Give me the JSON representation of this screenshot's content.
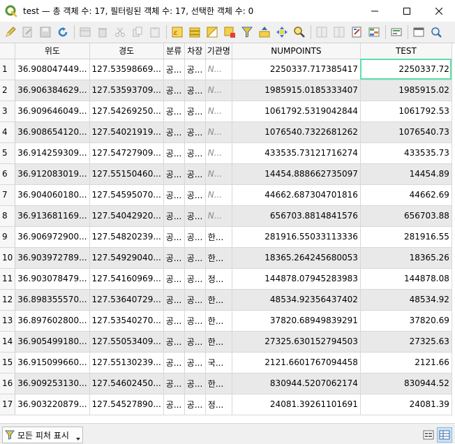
{
  "window": {
    "title": "test — 총 객체 수: 17, 필터링된 객체 수: 17, 선택한 객체 수: 0"
  },
  "toolbar": {
    "buttons": [
      "edit-pencil-icon",
      "multi-edit-icon",
      "save-icon",
      "reload-icon",
      "add-feature-icon",
      "delete-feature-icon",
      "cut-icon",
      "copy-icon",
      "paste-icon",
      "expression-select-icon",
      "select-all-icon",
      "invert-selection-icon",
      "deselect-icon",
      "filter-icon",
      "move-selection-top-icon",
      "pan-to-selection-icon",
      "zoom-to-selection-icon",
      "new-field-icon",
      "delete-field-icon",
      "field-calculator-icon",
      "conditional-format-icon",
      "actions-icon",
      "dock-icon",
      "attribute-form-icon"
    ]
  },
  "table": {
    "headers": [
      "위도",
      "경도",
      "분류",
      "차장",
      "기관명",
      "NUMPOINTS",
      "TEST"
    ],
    "rows": [
      {
        "n": "1",
        "lat": "36.908047449...",
        "lon": "127.53598669...",
        "cls": "공...",
        "car": "공...",
        "org": "N...",
        "np": "2250337.717385417",
        "test": "2250337.72"
      },
      {
        "n": "2",
        "lat": "36.906384629...",
        "lon": "127.53593709...",
        "cls": "공...",
        "car": "공...",
        "org": "N...",
        "np": "1985915.0185333407",
        "test": "1985915.02"
      },
      {
        "n": "3",
        "lat": "36.909646049...",
        "lon": "127.54269250...",
        "cls": "공...",
        "car": "공...",
        "org": "N...",
        "np": "1061792.5319042844",
        "test": "1061792.53"
      },
      {
        "n": "4",
        "lat": "36.908654120...",
        "lon": "127.54021919...",
        "cls": "공...",
        "car": "공...",
        "org": "N...",
        "np": "1076540.7322681262",
        "test": "1076540.73"
      },
      {
        "n": "5",
        "lat": "36.914259309...",
        "lon": "127.54727909...",
        "cls": "공...",
        "car": "공...",
        "org": "N...",
        "np": "433535.73121716274",
        "test": "433535.73"
      },
      {
        "n": "6",
        "lat": "36.912083019...",
        "lon": "127.55150460...",
        "cls": "공...",
        "car": "공...",
        "org": "N...",
        "np": "14454.888662735097",
        "test": "14454.89"
      },
      {
        "n": "7",
        "lat": "36.904060180...",
        "lon": "127.54595070...",
        "cls": "공...",
        "car": "공...",
        "org": "N...",
        "np": "44662.687304701816",
        "test": "44662.69"
      },
      {
        "n": "8",
        "lat": "36.913681169...",
        "lon": "127.54042920...",
        "cls": "공...",
        "car": "공...",
        "org": "N...",
        "np": "656703.8814841576",
        "test": "656703.88"
      },
      {
        "n": "9",
        "lat": "36.906972900...",
        "lon": "127.54820239...",
        "cls": "공...",
        "car": "공...",
        "org": "한...",
        "np": "281916.55033113336",
        "test": "281916.55"
      },
      {
        "n": "10",
        "lat": "36.903972789...",
        "lon": "127.54929040...",
        "cls": "공...",
        "car": "공...",
        "org": "한...",
        "np": "18365.264245680053",
        "test": "18365.26"
      },
      {
        "n": "11",
        "lat": "36.903078479...",
        "lon": "127.54160969...",
        "cls": "공...",
        "car": "공...",
        "org": "정...",
        "np": "144878.07945283983",
        "test": "144878.08"
      },
      {
        "n": "12",
        "lat": "36.898355570...",
        "lon": "127.53640729...",
        "cls": "공...",
        "car": "공...",
        "org": "한...",
        "np": "48534.92356437402",
        "test": "48534.92"
      },
      {
        "n": "13",
        "lat": "36.897602800...",
        "lon": "127.53540270...",
        "cls": "공...",
        "car": "공...",
        "org": "한...",
        "np": "37820.68949839291",
        "test": "37820.69"
      },
      {
        "n": "14",
        "lat": "36.905499180...",
        "lon": "127.55053409...",
        "cls": "공...",
        "car": "공...",
        "org": "한...",
        "np": "27325.630152794503",
        "test": "27325.63"
      },
      {
        "n": "15",
        "lat": "36.915099660...",
        "lon": "127.55130239...",
        "cls": "공...",
        "car": "공...",
        "org": "국...",
        "np": "2121.6601767094458",
        "test": "2121.66"
      },
      {
        "n": "16",
        "lat": "36.909253130...",
        "lon": "127.54602450...",
        "cls": "공...",
        "car": "공...",
        "org": "한...",
        "np": "830944.5207062174",
        "test": "830944.52"
      },
      {
        "n": "17",
        "lat": "36.903220879...",
        "lon": "127.54527890...",
        "cls": "공...",
        "car": "공...",
        "org": "정...",
        "np": "24081.39261101691",
        "test": "24081.39"
      }
    ]
  },
  "statusbar": {
    "filter_label": "모든 피처 표시"
  },
  "colors": {
    "selection_outline": "#5adfa9",
    "qgis_green": "#589632",
    "row_alt": "#e9e9e9"
  }
}
